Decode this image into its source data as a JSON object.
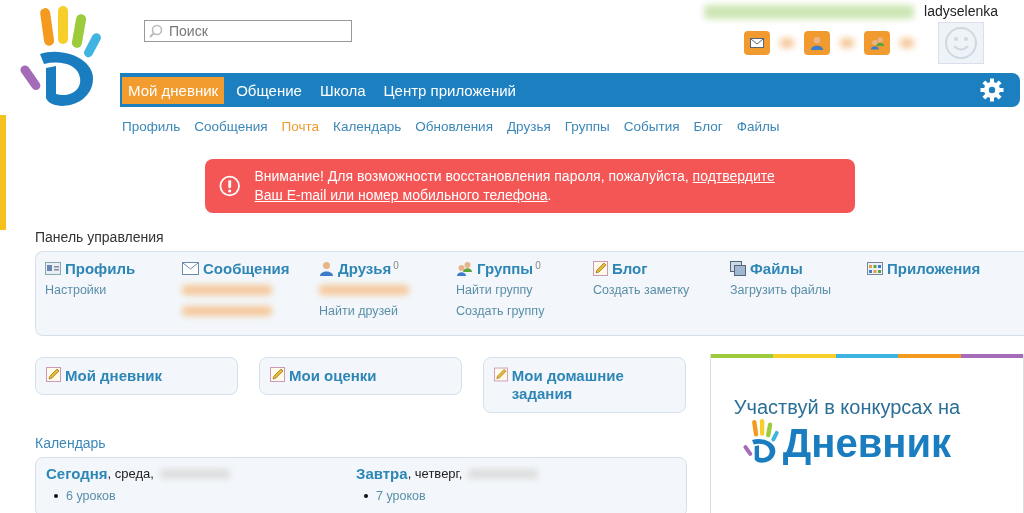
{
  "header": {
    "search": {
      "placeholder": "Поиск"
    },
    "username": "ladyselenka",
    "notifications": [
      {
        "kind": "mail"
      },
      {
        "kind": "friend"
      },
      {
        "kind": "group"
      }
    ]
  },
  "nav": {
    "tabs": [
      {
        "label": "Мой дневник",
        "selected": true
      },
      {
        "label": "Общение",
        "selected": false
      },
      {
        "label": "Школа",
        "selected": false
      },
      {
        "label": "Центр приложений",
        "selected": false
      }
    ]
  },
  "subnav": [
    {
      "label": "Профиль",
      "selected": false
    },
    {
      "label": "Сообщения",
      "selected": false
    },
    {
      "label": "Почта",
      "selected": true
    },
    {
      "label": "Календарь",
      "selected": false
    },
    {
      "label": "Обновления",
      "selected": false
    },
    {
      "label": "Друзья",
      "selected": false
    },
    {
      "label": "Группы",
      "selected": false
    },
    {
      "label": "События",
      "selected": false
    },
    {
      "label": "Блог",
      "selected": false
    },
    {
      "label": "Файлы",
      "selected": false
    }
  ],
  "alert": {
    "text": "Внимание! Для возможности восстановления пароля, пожалуйста, ",
    "link": "подтвердите",
    "link_2": "Ваш E-mail или номер мобильного телефона",
    "end": "."
  },
  "panel": {
    "title": "Панель управления",
    "sections": [
      {
        "kind": "profile",
        "title": "Профиль",
        "links": [
          {
            "kind": "link",
            "label": "Настройки"
          }
        ]
      },
      {
        "kind": "mail",
        "title": "Сообщения",
        "links": [
          {
            "kind": "blurred"
          },
          {
            "kind": "blurred"
          }
        ]
      },
      {
        "kind": "friends",
        "title": "Друзья",
        "count": "0",
        "links": [
          {
            "kind": "blurred"
          },
          {
            "kind": "link",
            "label": "Найти друзей"
          }
        ]
      },
      {
        "kind": "groups",
        "title": "Группы",
        "count": "0",
        "links": [
          {
            "kind": "link",
            "label": "Найти группу"
          },
          {
            "kind": "link",
            "label": "Создать группу"
          }
        ]
      },
      {
        "kind": "blog",
        "title": "Блог",
        "links": [
          {
            "kind": "link",
            "label": "Создать заметку"
          }
        ]
      },
      {
        "kind": "files",
        "title": "Файлы",
        "links": [
          {
            "kind": "link",
            "label": "Загрузить файлы"
          }
        ]
      },
      {
        "kind": "apps",
        "title": "Приложения"
      }
    ]
  },
  "tiles": [
    {
      "title": "Мой дневник"
    },
    {
      "title": "Мои оценки"
    },
    {
      "title": "Мои домашние задания"
    }
  ],
  "calendar": {
    "title": "Календарь",
    "days": [
      {
        "name": "Сегодня",
        "weekday": ", среда,",
        "lessons": "6 уроков"
      },
      {
        "name": "Завтра",
        "weekday": ", четверг,",
        "lessons": "7 уроков"
      }
    ]
  },
  "banner": {
    "text": "Участвуй в конкурсах на",
    "logo": "Дневник"
  }
}
